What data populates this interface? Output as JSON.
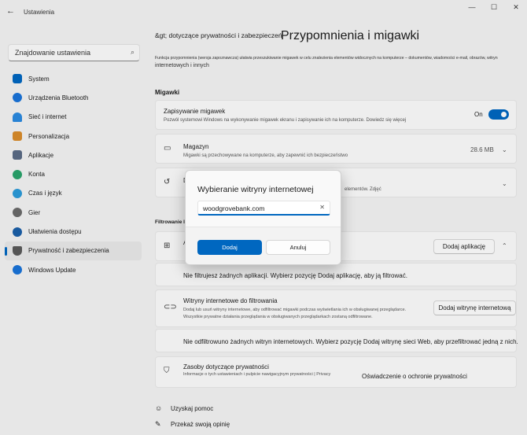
{
  "window": {
    "title": "Ustawienia",
    "back": "←",
    "minimize": "—",
    "maximize": "☐",
    "close": "✕"
  },
  "search": {
    "placeholder": "Znajdowanie ustawienia"
  },
  "sidebar": {
    "items": [
      {
        "label": "System",
        "color": "#0067c0"
      },
      {
        "label": "Urządzenia Bluetooth",
        "color": "#1a73d9"
      },
      {
        "label": "Sieć i internet",
        "color": "#2b8ae0"
      },
      {
        "label": "Personalizacja",
        "color": "#d98c2b"
      },
      {
        "label": "Aplikacje",
        "color": "#5a6b85"
      },
      {
        "label": "Konta",
        "color": "#2aa36b"
      },
      {
        "label": "Czas i język",
        "color": "#2b9ad9"
      },
      {
        "label": "Gier",
        "color": "#6b6b6b"
      },
      {
        "label": "Ułatwienia dostępu",
        "color": "#1b5fa8"
      },
      {
        "label": "Prywatność i zabezpieczenia",
        "color": "#5a5a5a"
      },
      {
        "label": "Windows Update",
        "color": "#1a73d9"
      }
    ]
  },
  "header": {
    "breadcrumb": "&gt; dotyczące prywatności i zabezpieczeń",
    "title": "Przypomnienia i migawki",
    "description": "Funkcja przypomnienia (wersja zapoznawcza) ułatwia przeszukiwanie migawek w celu znalezienia elementów widocznych na komputerze – dokumentów, wiadomości e-mail, obrazów, witryn",
    "description2": "internetowych i innych"
  },
  "snapshots": {
    "section": "Migawki",
    "save": {
      "title": "Zapisywanie migawek",
      "sub": "Pozwól systemowi Windows na wykonywanie migawek ekranu i zapisywanie ich na komputerze. Dowiedz się więcej",
      "state": "On"
    },
    "storage": {
      "title": "Magazyn",
      "sub": "Migawki są przechowywane na komputerze, aby zapewnić ich bezpieczeństwo",
      "size": "28.6 MB"
    },
    "delete": {
      "title": "D",
      "sub": "elementów. Zdjęć"
    }
  },
  "filter": {
    "section": "Filtrowanie list",
    "apps": {
      "title": "A",
      "button": "Dodaj aplikację",
      "empty": "Nie filtrujesz żadnych aplikacji. Wybierz pozycję Dodaj aplikację, aby ją filtrować."
    },
    "sites": {
      "title": "Witryny internetowe do filtrowania",
      "sub": "Dodaj lub usuń witryny internetowe, aby odfiltrować migawki podczas wyświetlania ich w obsługiwanej przeglądarce.",
      "sub2": "Wszystkie prywatne działania przeglądania w obsługiwanych przeglądarkach zostaną odfiltrowane.",
      "button": "Dodaj witrynę internetową",
      "empty": "Nie odfiltrowuno żadnych witryn internetowych. Wybierz pozycję Dodaj witrynę sieci Web, aby przefiltrować jedną z nich."
    }
  },
  "privacy": {
    "title": "Zasoby dotyczące prywatności",
    "sub": "Informacje o tych ustawieniach i pulpicie nawigacyjnym prywatności | Privacy",
    "link": "Oświadczenie o ochronie prywatności"
  },
  "links": {
    "help": "Uzyskaj pomoc",
    "feedback": "Przekaż swoją opinię"
  },
  "dialog": {
    "title": "Wybieranie witryny internetowej",
    "input_value": "woodgrovebank.com",
    "clear": "✕",
    "primary": "Dodaj",
    "secondary": "Anuluj"
  }
}
